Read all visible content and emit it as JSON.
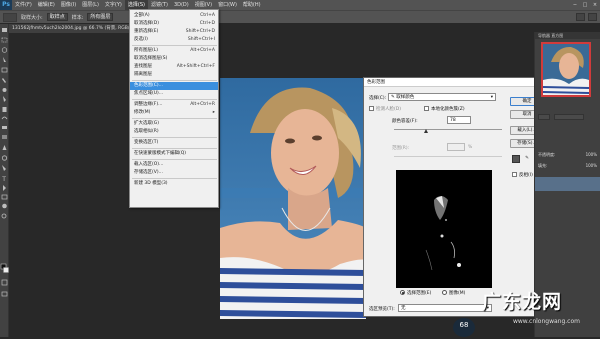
{
  "app": {
    "logo": "Ps"
  },
  "menubar": {
    "items": [
      "文件(F)",
      "编辑(E)",
      "图像(I)",
      "图层(L)",
      "文字(Y)",
      "选择(S)",
      "滤镜(T)",
      "3D(D)",
      "视图(V)",
      "窗口(W)",
      "帮助(H)"
    ],
    "active_index": 5,
    "window_buttons": [
      "−",
      "□",
      "×"
    ]
  },
  "optbar": {
    "size_label": "取样大小:",
    "size_value": "取样点",
    "sample_label": "样本:",
    "sample_value": "所有图层"
  },
  "doc_tab": {
    "title": "131562jfhmtv5uch2lo2004.jpg @ 66.7% (背景, RGB/8)"
  },
  "select_menu": {
    "items": [
      {
        "label": "全部(A)",
        "shortcut": "Ctrl+A",
        "state": "normal"
      },
      {
        "label": "取消选择(D)",
        "shortcut": "Ctrl+D",
        "state": "normal"
      },
      {
        "label": "重新选择(E)",
        "shortcut": "Shift+Ctrl+D",
        "state": "normal"
      },
      {
        "label": "反选(I)",
        "shortcut": "Shift+Ctrl+I",
        "state": "normal"
      },
      {
        "sep": true
      },
      {
        "label": "所有图层(L)",
        "shortcut": "Alt+Ctrl+A",
        "state": "normal"
      },
      {
        "label": "取消选择图层(S)",
        "shortcut": "",
        "state": "normal"
      },
      {
        "label": "查找图层",
        "shortcut": "Alt+Shift+Ctrl+F",
        "state": "normal"
      },
      {
        "label": "隔离图层",
        "shortcut": "",
        "state": "normal"
      },
      {
        "sep": true
      },
      {
        "label": "色彩范围(C)...",
        "shortcut": "",
        "state": "highlight"
      },
      {
        "label": "焦点区域(U)...",
        "shortcut": "",
        "state": "normal"
      },
      {
        "sep": true
      },
      {
        "label": "调整边缘(F)...",
        "shortcut": "Alt+Ctrl+R",
        "state": "normal"
      },
      {
        "label": "修改(M)",
        "shortcut": "▸",
        "state": "normal"
      },
      {
        "sep": true
      },
      {
        "label": "扩大选取(G)",
        "shortcut": "",
        "state": "normal"
      },
      {
        "label": "选取相似(R)",
        "shortcut": "",
        "state": "normal"
      },
      {
        "sep": true
      },
      {
        "label": "变换选区(T)",
        "shortcut": "",
        "state": "normal"
      },
      {
        "sep": true
      },
      {
        "label": "在快速蒙版模式下编辑(Q)",
        "shortcut": "",
        "state": "normal"
      },
      {
        "sep": true
      },
      {
        "label": "载入选区(O)...",
        "shortcut": "",
        "state": "normal"
      },
      {
        "label": "存储选区(V)...",
        "shortcut": "",
        "state": "normal"
      },
      {
        "sep": true
      },
      {
        "label": "新建 3D 模型(3)",
        "shortcut": "",
        "state": "normal"
      }
    ]
  },
  "dialog": {
    "title": "色彩范围",
    "close": "×",
    "select_label": "选择(C):",
    "select_value": "取样颜色",
    "detect_faces": "检测人脸(D)",
    "localized": "本地化颜色簇(Z)",
    "fuzziness_label": "颜色容差(F):",
    "fuzziness_value": "78",
    "range_label": "范围(R):",
    "range_unit": "%",
    "ok": "确定",
    "cancel": "取消",
    "load": "载入(L)...",
    "save": "存储(S)...",
    "invert": "反相(I)",
    "radio_selection": "选择范围(E)",
    "radio_image": "图像(M)",
    "preview_label": "选区预览(T):",
    "preview_value": "无"
  },
  "panels": {
    "nav_tabs": "导航器  直方图",
    "layer_rows": [
      {
        "label": "不透明度:",
        "value": "100%"
      },
      {
        "label": "填充:",
        "value": "100%"
      }
    ]
  },
  "zoom_badge": "68",
  "watermark": {
    "main": "广东龙网",
    "sub": "www.cnlongwang.com"
  }
}
